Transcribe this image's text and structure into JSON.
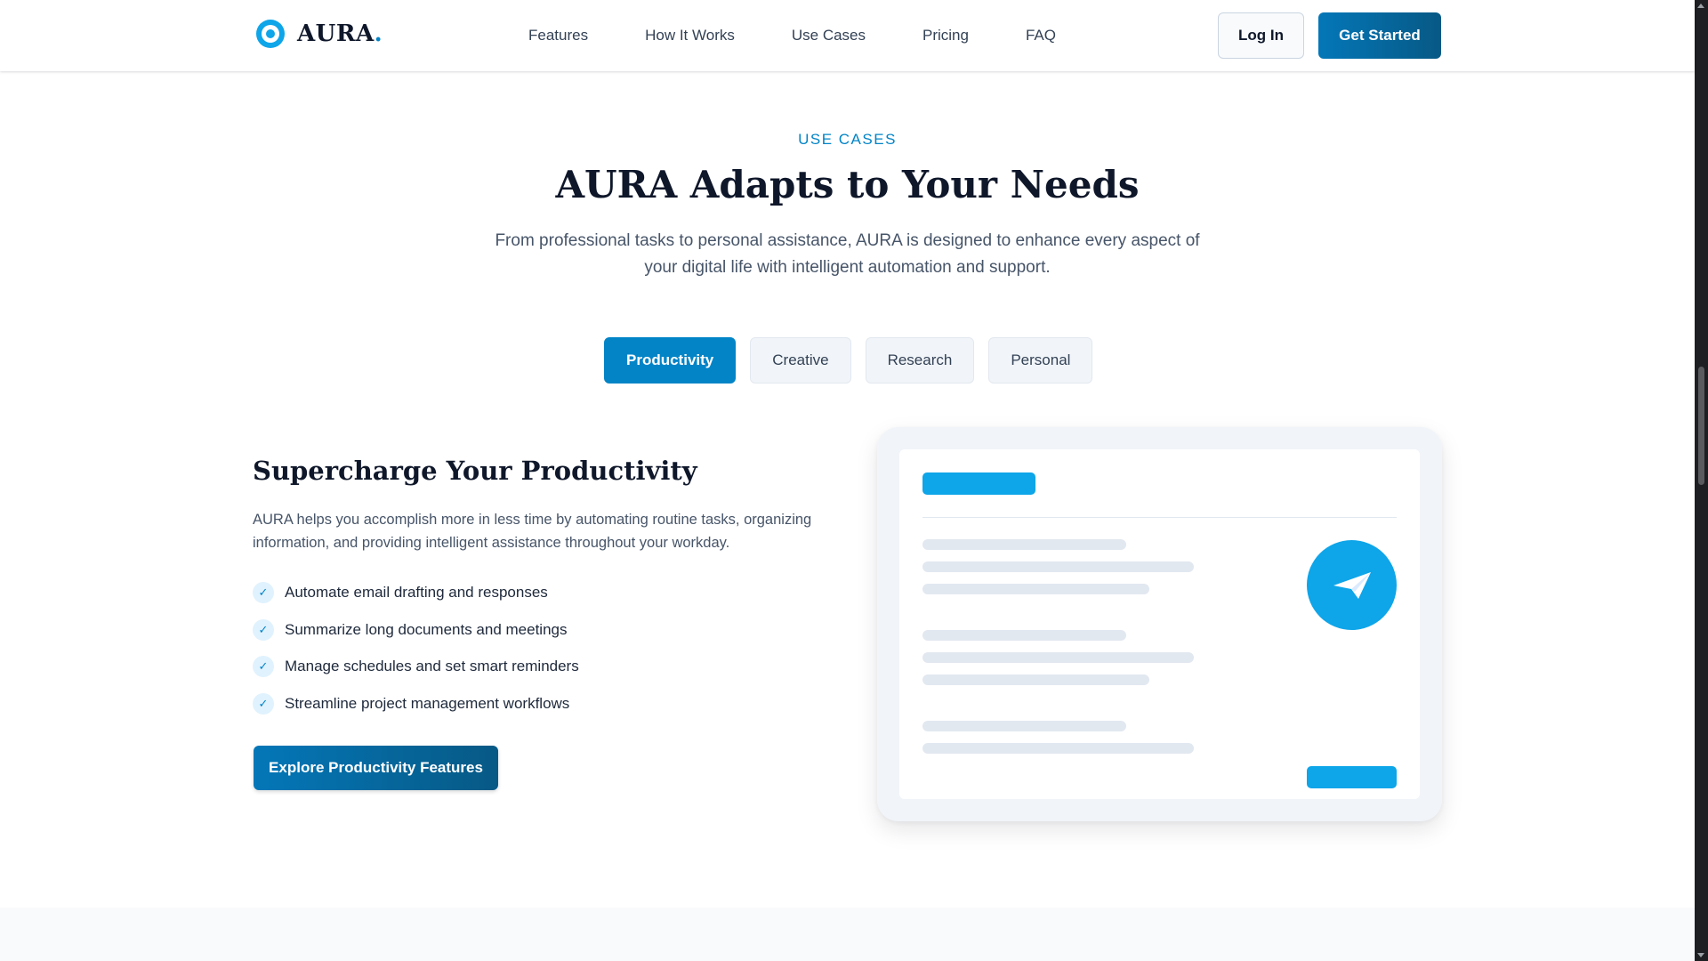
{
  "brand": {
    "name": "AURA",
    "dot": "."
  },
  "nav": {
    "items": [
      "Features",
      "How It Works",
      "Use Cases",
      "Pricing",
      "FAQ"
    ],
    "login_label": "Log In",
    "cta_label": "Get Started"
  },
  "section": {
    "eyebrow": "USE CASES",
    "title": "AURA Adapts to Your Needs",
    "description": "From professional tasks to personal assistance, AURA is designed to enhance every aspect of your digital life with intelligent automation and support."
  },
  "tabs": [
    {
      "label": "Productivity",
      "active": true
    },
    {
      "label": "Creative",
      "active": false
    },
    {
      "label": "Research",
      "active": false
    },
    {
      "label": "Personal",
      "active": false
    }
  ],
  "panel": {
    "title": "Supercharge Your Productivity",
    "description": "AURA helps you accomplish more in less time by automating routine tasks, organizing information, and providing intelligent assistance throughout your workday.",
    "features": [
      "Automate email drafting and responses",
      "Summarize long documents and meetings",
      "Manage schedules and set smart reminders",
      "Streamline project management workflows"
    ],
    "button_label": "Explore Productivity Features"
  },
  "illustration": {
    "icon": "paper-plane-icon"
  },
  "colors": {
    "accent": "#0284c7",
    "accent_light": "#0ea5e9",
    "accent_dark": "#075985",
    "text": "#0f172a",
    "muted": "#475569"
  }
}
